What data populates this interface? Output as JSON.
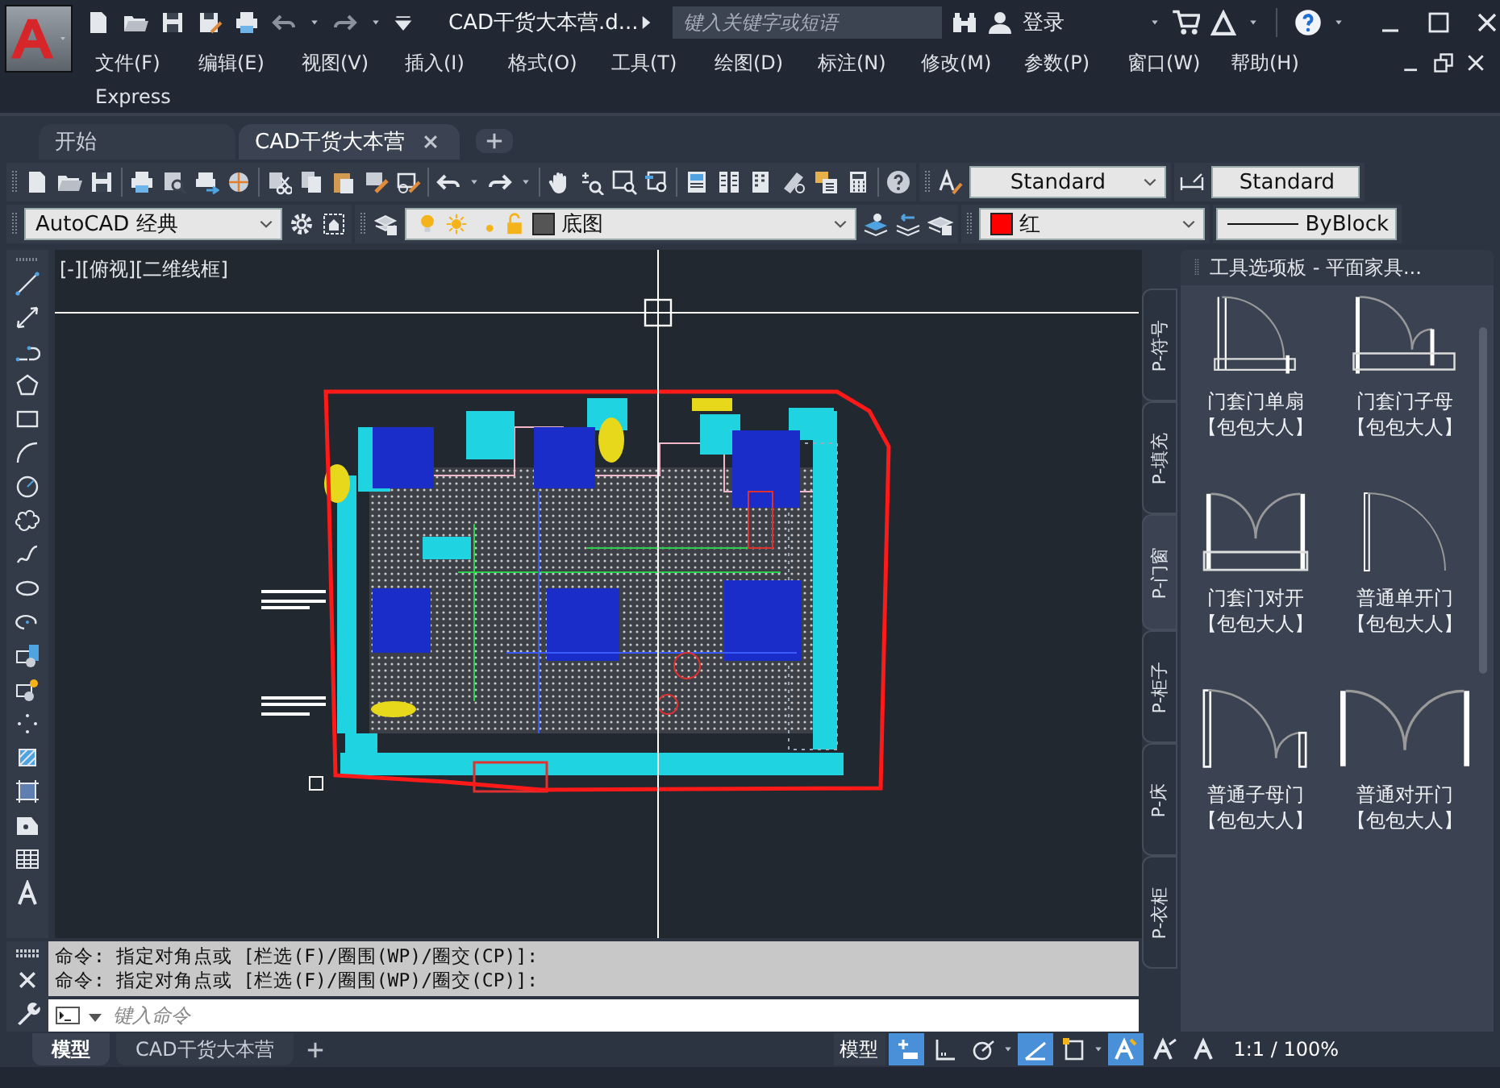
{
  "window": {
    "title": "CAD干货大本营.d..."
  },
  "search": {
    "placeholder": "键入关键字或短语"
  },
  "account": {
    "label": "登录"
  },
  "menu": [
    "文件(F)",
    "编辑(E)",
    "视图(V)",
    "插入(I)",
    "格式(O)",
    "工具(T)",
    "绘图(D)",
    "标注(N)",
    "修改(M)",
    "参数(P)",
    "窗口(W)",
    "帮助(H)",
    "Express"
  ],
  "document_tabs": [
    {
      "label": "开始",
      "selected": false
    },
    {
      "label": "CAD干货大本营",
      "selected": true
    }
  ],
  "styles_toolbar": {
    "text_style": "Standard",
    "dimension_style": "Standard"
  },
  "properties_toolbar": {
    "workspace": "AutoCAD 经典",
    "layer": "底图",
    "color_label": "红",
    "linetype": "ByBlock"
  },
  "viewport": {
    "label": "[-][俯视][二维线框]"
  },
  "tool_palette": {
    "title": "工具选项板 - 平面家具...",
    "tabs": [
      {
        "label": "P-符号",
        "selected": false
      },
      {
        "label": "P-填充",
        "selected": false
      },
      {
        "label": "P-门窗",
        "selected": true
      },
      {
        "label": "P-柜子",
        "selected": false
      },
      {
        "label": "P-床",
        "selected": false
      },
      {
        "label": "P-衣柜",
        "selected": false
      }
    ],
    "items": [
      {
        "name": "门套门单扇",
        "author": "【包包大人】"
      },
      {
        "name": "门套门子母",
        "author": "【包包大人】"
      },
      {
        "name": "门套门对开",
        "author": "【包包大人】"
      },
      {
        "name": "普通单开门",
        "author": "【包包大人】"
      },
      {
        "name": "普通子母门",
        "author": "【包包大人】"
      },
      {
        "name": "普通对开门",
        "author": "【包包大人】"
      }
    ]
  },
  "command_line": {
    "history": [
      "命令: 指定对角点或 [栏选(F)/圈围(WP)/圈交(CP)]:",
      "命令: 指定对角点或 [栏选(F)/圈围(WP)/圈交(CP)]:"
    ],
    "placeholder": "键入命令"
  },
  "layout_tabs": [
    {
      "label": "模型",
      "selected": true
    },
    {
      "label": "CAD干货大本营",
      "selected": false
    }
  ],
  "status_bar": {
    "space": "模型",
    "toggles": [
      {
        "on": true
      },
      {
        "on": false
      },
      {
        "on": false
      },
      {
        "on": true
      },
      {
        "on": false
      },
      {
        "on": true
      },
      {
        "on": false
      },
      {
        "on": false
      }
    ],
    "scale": "1:1 / 100%"
  }
}
